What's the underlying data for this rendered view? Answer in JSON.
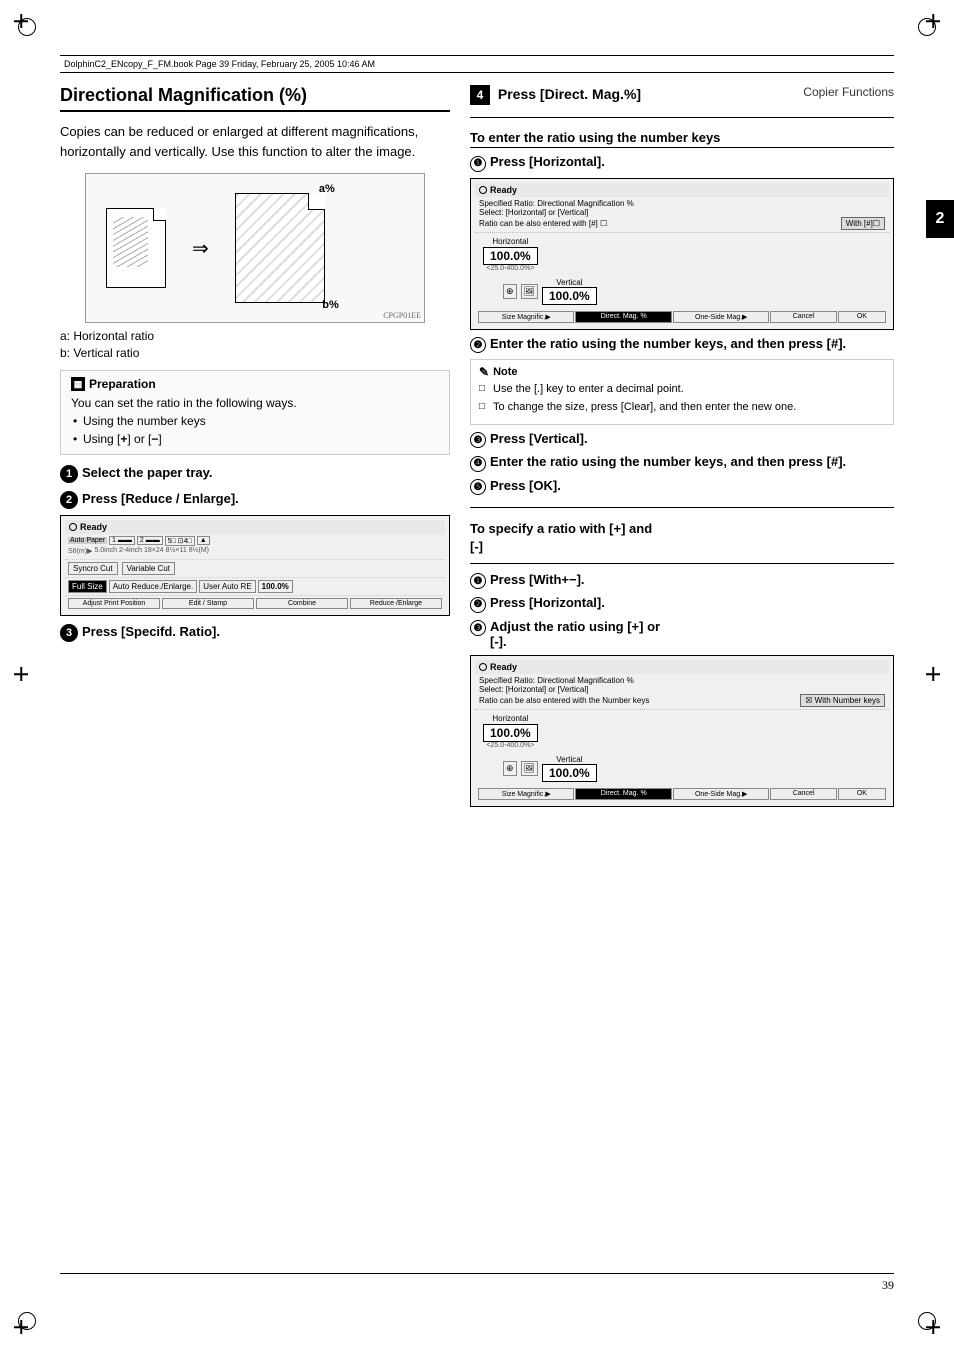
{
  "page": {
    "number": "39",
    "header_text": "DolphinC2_ENcopy_F_FM.book  Page 39  Friday, February 25, 2005  10:46 AM",
    "section_label": "Copier Functions",
    "chapter_num": "2"
  },
  "left": {
    "title": "Directional Magnification (%)",
    "intro": "Copies can be reduced or enlarged at different magnifications, horizontally and vertically. Use this function to alter the image.",
    "label_a": "a: Horizontal ratio",
    "label_b": "b: Vertical ratio",
    "diagram_label_a": "a%",
    "diagram_label_b": "b%",
    "cp_label": "CPGP01EE",
    "prep_title": "Preparation",
    "prep_text": "You can set the ratio in the following ways.",
    "bullet1": "Using the number keys",
    "bullet2": "Using [+] or [-]",
    "step1_text": "Select the paper tray.",
    "step2_text": "Press [Reduce / Enlarge].",
    "step3_text": "Press [Specifd. Ratio].",
    "screen1": {
      "ready": "Ready",
      "row1": "Auto Paper | 1 | 2 | 5□ | 4□ | ▲",
      "row2": "S6(m)▶ | 5.0inch | 2-4inch | 18×24 | 8½×11 | 8½(M)",
      "row3": "Syncro Cut | Variable Cut",
      "row4": "Full Size | Auto Reduce./Enlarge. | User Auto RE | 100.0%",
      "row5": "Adjust Print Position | Edit / Stamp | Combine | Reduce /Enlarge"
    }
  },
  "right": {
    "step4_text": "Press [Direct. Mag.%]",
    "subsection1_title": "To enter the ratio using the number keys",
    "sub1_step1": "Press [Horizontal].",
    "screen2": {
      "ready": "Ready",
      "title": "Specified Ratio: Directional Magnification %",
      "subtitle": "Select: [Horizontal] or [Vertical]",
      "subtitle2": "Ratio can be also entered with [#] ☐",
      "with_btn": "With [#]☐",
      "horizontal_label": "Horizontal",
      "horizontal_value": "100.0%",
      "horizontal_range": "<25.0-400.0%>",
      "vertical_label": "Vertical",
      "vertical_value": "100.0%",
      "btn1": "Size Magnific.▶",
      "btn2": "Direct. Mag. %",
      "btn3": "One-Side Mag.▶",
      "btn4": "Cancel",
      "btn5": "OK"
    },
    "sub1_step2": "Enter the ratio using the number keys, and then press [#].",
    "note_title": "Note",
    "note1": "Use the [.] key to enter a decimal point.",
    "note2": "To change the size, press [Clear], and then enter the new one.",
    "sub1_step3": "Press [Vertical].",
    "sub1_step4": "Enter the ratio using the number keys, and then press [#].",
    "sub1_step5": "Press [OK].",
    "divider": true,
    "subsection2_title_line1": "To specify a ratio with [+] and",
    "subsection2_title_line2": "[-]",
    "sub2_step1": "Press [With+−].",
    "sub2_step2": "Press [Horizontal].",
    "sub2_step3_line1": "Adjust the ratio using [+] or",
    "sub2_step3_line2": "[-].",
    "screen3": {
      "ready": "Ready",
      "title": "Specified Ratio: Directional Magnification %",
      "subtitle": "Select: [Horizontal] or [Vertical]",
      "subtitle2": "Ratio can be also entered with the Number keys",
      "with_btn": "☒ With Number keys",
      "horizontal_label": "Horizontal",
      "horizontal_value": "100.0%",
      "horizontal_range": "<25.0-400.0%>",
      "vertical_label": "Vertical",
      "vertical_value": "100.0%",
      "btn1": "Size Magnific.▶",
      "btn2": "Direct. Mag. %",
      "btn3": "One-Side Mag.▶",
      "btn4": "Cancel",
      "btn5": "OK"
    }
  }
}
